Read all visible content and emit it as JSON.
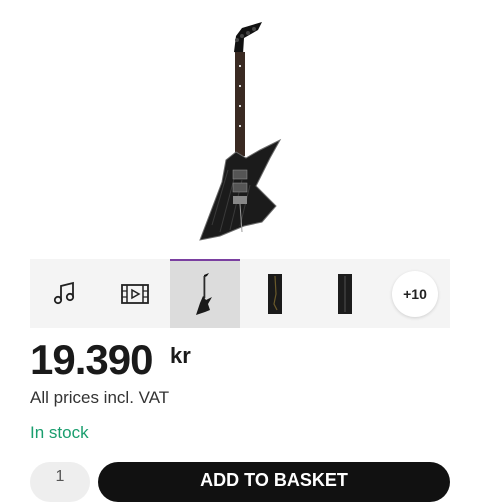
{
  "gallery": {
    "thumbnails": [
      {
        "icon": "music-notes-icon",
        "active": false
      },
      {
        "icon": "video-icon",
        "active": false
      },
      {
        "icon": "guitar-thumbnail",
        "active": true
      },
      {
        "icon": "guitar-body-thumbnail",
        "active": false
      },
      {
        "icon": "guitar-back-thumbnail",
        "active": false
      }
    ],
    "more_label": "+10",
    "active_color": "#7a3fa0"
  },
  "product": {
    "price": "19.390",
    "currency": "kr",
    "vat_note": "All prices incl. VAT",
    "stock_status": "In stock",
    "stock_color": "#1a9e6e"
  },
  "cart": {
    "quantity": "1",
    "add_label": "ADD TO BASKET"
  }
}
